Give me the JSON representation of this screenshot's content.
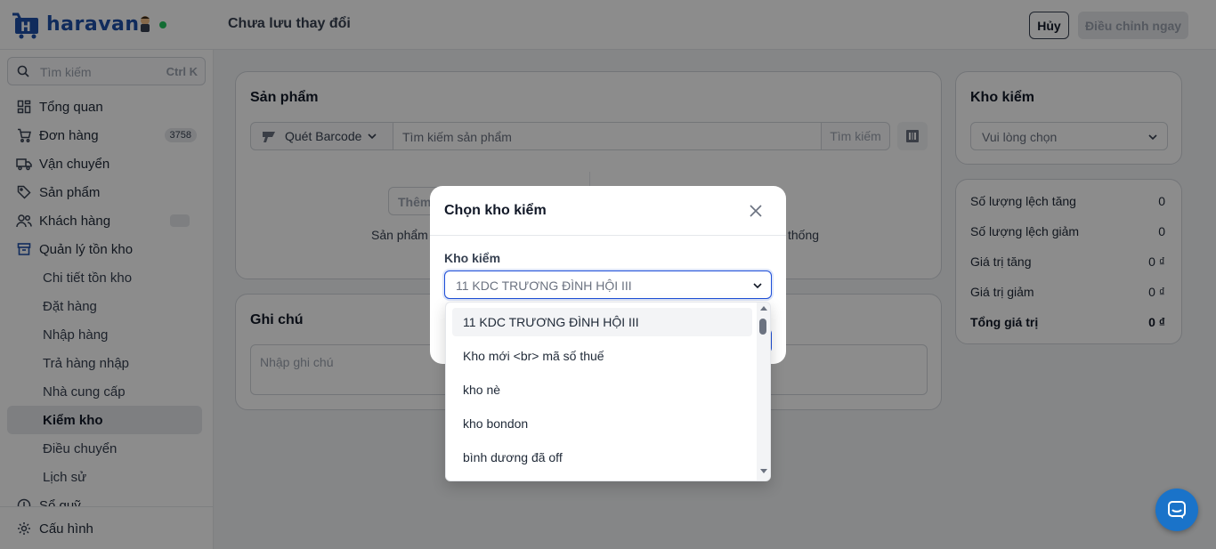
{
  "header": {
    "logo_text": "haravan",
    "status_text": "Chưa lưu thay đổi",
    "cancel_label": "Hủy",
    "adjust_label": "Điều chỉnh ngay"
  },
  "sidebar": {
    "search_placeholder": "Tìm kiếm",
    "search_shortcut": "Ctrl K",
    "items": [
      {
        "label": "Tổng quan"
      },
      {
        "label": "Đơn hàng",
        "badge": "3758"
      },
      {
        "label": "Vận chuyển"
      },
      {
        "label": "Sản phẩm"
      },
      {
        "label": "Khách hàng"
      },
      {
        "label": "Quản lý tồn kho"
      }
    ],
    "subitems": [
      {
        "label": "Chi tiết tồn kho"
      },
      {
        "label": "Đặt hàng"
      },
      {
        "label": "Nhập hàng"
      },
      {
        "label": "Trả hàng nhập"
      },
      {
        "label": "Nhà cung cấp"
      },
      {
        "label": "Kiểm kho"
      },
      {
        "label": "Điều chuyển"
      },
      {
        "label": "Lịch sử"
      }
    ],
    "partial_item": "Sổ quỹ",
    "settings_label": "Cấu hình"
  },
  "products_card": {
    "title": "Sản phẩm",
    "barcode_label": "Quét Barcode",
    "search_placeholder": "Tìm kiếm sản phẩm",
    "search_button": "Tìm kiếm",
    "add_button_partial": "Thêm",
    "hint_left": "Sản phẩm",
    "hint_right": "thống"
  },
  "notes_card": {
    "title": "Ghi chú",
    "placeholder": "Nhập ghi chú"
  },
  "warehouse_card": {
    "title": "Kho kiểm",
    "select_placeholder": "Vui lòng chọn"
  },
  "summary": {
    "rows": [
      {
        "label": "Số lượng lệch tăng",
        "value": "0"
      },
      {
        "label": "Số lượng lệch giảm",
        "value": "0"
      },
      {
        "label": "Giá trị tăng",
        "value": "0 ₫"
      },
      {
        "label": "Giá trị giảm",
        "value": "0 ₫"
      }
    ],
    "total_label": "Tổng giá trị",
    "total_value": "0 ₫"
  },
  "modal": {
    "title": "Chọn kho kiểm",
    "field_label": "Kho kiểm",
    "selected_value": "11 KDC TRƯƠNG ĐÌNH HỘI III",
    "options": [
      "11 KDC TRƯƠNG ĐÌNH HỘI III",
      "Kho mới <br> mã số thuế",
      "kho nè",
      "kho bondon",
      "bình dương đã off"
    ]
  },
  "colors": {
    "primary": "#1d4ed8",
    "chat": "#1a73c9",
    "online_dot": "#22c55e"
  }
}
